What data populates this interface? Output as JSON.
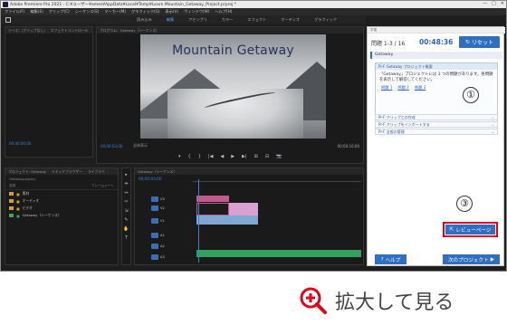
{
  "window": {
    "title": "Adobe Premiere Pro 2021 - C:¥ユーザー¥ames¥AppData¥Local¥Temp¥Learn Mountain_Getaway_Project.prproj *",
    "controls": [
      "—",
      "□",
      "✕"
    ]
  },
  "menu": [
    "ファイル(F)",
    "編集(E)",
    "クリップ(C)",
    "シーケンス(S)",
    "マーカー(M)",
    "グラフィック(G)",
    "表示(V)",
    "ウィンドウ(W)",
    "ヘルプ(H)"
  ],
  "workspaces": {
    "items": [
      "読み込み",
      "編集",
      "アセンブリ",
      "カラー",
      "エフェクト",
      "オーディオ",
      "グラフィック"
    ],
    "active_index": 1
  },
  "source_panel": {
    "tabs": [
      "ソース：(クリップなし)",
      "エフェクトコントロール"
    ],
    "timecode": "00;00;00;00"
  },
  "program_panel": {
    "tab": "プログラム：Getaway（シーケンス）",
    "video_title": "Mountain Getaway",
    "timecode": "00;00;03;00",
    "fit": "全体表示",
    "duration": "00;00;10;00",
    "controls": [
      "▾",
      "{",
      "}",
      "|◀",
      "◀",
      "▶",
      "▶|",
      "⊞",
      "⊟",
      "📷"
    ]
  },
  "project_panel": {
    "tabs": [
      "プロジェクト: Getaway",
      "メディアブラウザー",
      "ライブラリ"
    ],
    "path": "Getaway.prproj",
    "columns": [
      "名前",
      "フレームレート"
    ],
    "items": [
      {
        "name": "素材",
        "color": "#c8a13b"
      },
      {
        "name": "オーディオ",
        "color": "#c8a13b"
      },
      {
        "name": "ビデオ",
        "color": "#c8a13b"
      },
      {
        "name": "Getaway（シーケンス）",
        "color": "#4e9e5b"
      }
    ]
  },
  "tools": [
    "▸",
    "⇹",
    "⇔",
    "✂",
    "⇲",
    "✎",
    "✋",
    "T"
  ],
  "timeline": {
    "tab": "Getaway（シーケンス）",
    "timecode": "00;00;03;00",
    "tracks": [
      "V3",
      "V2",
      "V1",
      "A1",
      "A2",
      "A3"
    ],
    "clip_label": "グラフィック"
  },
  "learn_panel": {
    "header": "学習",
    "counter": "問題 1-3 / 16",
    "timer": "00:48:36",
    "reset_label": "リセット",
    "section_title": "Getaway",
    "question_header": "Pr-F Getaway プロジェクト概要",
    "question_text": "「Getaway」プロジェクトには 3 つの問題があります。各問題を表示して解答してください。",
    "question_links": [
      "問題 1",
      "問題 2",
      "問題 3"
    ],
    "rows": [
      "Pr-F クリップとの作成",
      "Pr-F クリップをインポートする",
      "Pr-F 全般の管理"
    ],
    "review_label": "レビューページ",
    "help_label": "ヘルプ",
    "next_label": "次のプロジェクト"
  },
  "markers": [
    "②",
    "①",
    "③"
  ],
  "caption": {
    "text": "拡大して見る",
    "icon": "zoom-in-icon",
    "accent": "#e3001b"
  }
}
